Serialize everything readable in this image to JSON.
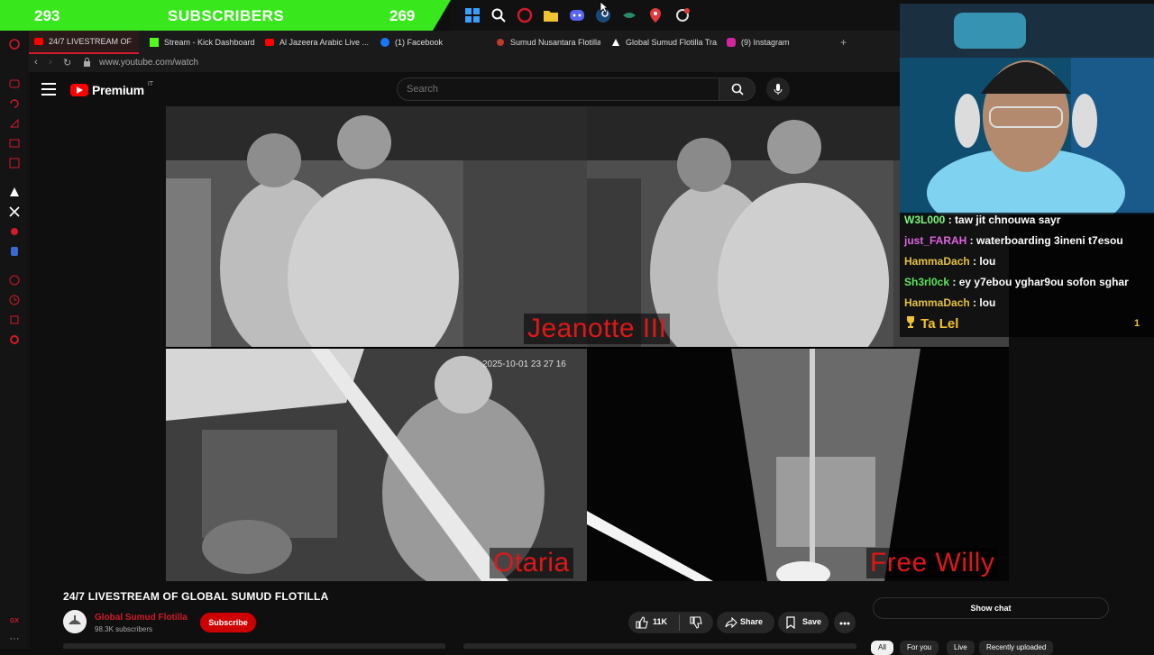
{
  "overlay": {
    "subscribers_title": "SUBSCRIBERS",
    "left_count": "293",
    "right_count": "269"
  },
  "taskbar": {
    "icons": [
      "windows-icon",
      "search-icon",
      "opera-icon",
      "folder-icon",
      "discord-icon",
      "steam-icon",
      "app-icon",
      "maps-pin-icon",
      "settings-icon"
    ]
  },
  "browser": {
    "tabs": [
      {
        "label": "24/7 LIVESTREAM OF",
        "icon": "youtube-icon",
        "active": true
      },
      {
        "label": "Stream - Kick Dashboard",
        "icon": "kick-icon"
      },
      {
        "label": "Al Jazeera Arabic Live ...",
        "icon": "youtube-icon"
      },
      {
        "label": "(1) Facebook",
        "icon": "facebook-icon"
      },
      {
        "label": "Sumud Nusantara Flotilla",
        "icon": "site-icon"
      },
      {
        "label": "Global Sumud Flotilla Tra...",
        "icon": "site-icon"
      },
      {
        "label": "(9) Instagram",
        "icon": "instagram-icon"
      }
    ],
    "new_tab": "+",
    "url": "www.youtube.com/watch"
  },
  "youtube": {
    "logo_text": "Premium",
    "region": "IT",
    "search_placeholder": "Search"
  },
  "video": {
    "cameras": [
      {
        "label": "Jeanotte III"
      },
      {
        "label": "Otaria"
      },
      {
        "label": "Free Willy"
      }
    ],
    "timestamp": "2025-10-01 23 27 16"
  },
  "chat": {
    "messages": [
      {
        "user": "W3L000",
        "color": "#7cf57c",
        "text": "taw jit chnouwa sayr"
      },
      {
        "user": "just_FARAH",
        "color": "#e063e0",
        "text": "waterboarding 3ineni t7esou"
      },
      {
        "user": "HammaDach",
        "color": "#e3c23d",
        "text": "lou"
      },
      {
        "user": "Sh3rl0ck",
        "color": "#5de35d",
        "text": "ey y7ebou yghar9ou sofon sghar"
      },
      {
        "user": "HammaDach",
        "color": "#e3c23d",
        "text": "lou"
      }
    ],
    "leader": {
      "name": "Ta Lel",
      "count": "1"
    }
  },
  "watch": {
    "title": "24/7 LIVESTREAM OF GLOBAL SUMUD FLOTILLA",
    "channel_name": "Global Sumud Flotilla",
    "subscribers": "98.3K subscribers",
    "subscribe_label": "Subscribe",
    "likes": "11K",
    "share_label": "Share",
    "save_label": "Save",
    "show_chat_label": "Show chat",
    "chips": [
      "All",
      "For you",
      "Live",
      "Recently uploaded"
    ]
  },
  "rail": {
    "bottom_label": "GX"
  }
}
